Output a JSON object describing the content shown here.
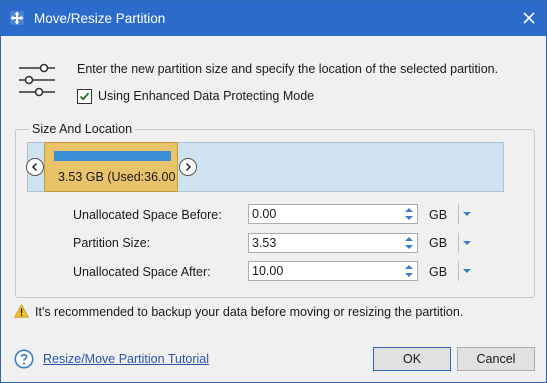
{
  "window": {
    "title": "Move/Resize Partition",
    "icon": "move-resize-app-icon"
  },
  "intro": {
    "description": "Enter the new partition size and specify the location of the selected partition.",
    "protect_mode_label": "Using Enhanced Data Protecting Mode",
    "protect_mode_checked": true,
    "icon": "sliders-icon"
  },
  "size_location": {
    "group_label": "Size And Location",
    "partition_label": "3.53 GB (Used:36.00",
    "partition_color": "#e8c36a",
    "track_color": "#cfe2ef",
    "used_bar_color": "#3a8fd4"
  },
  "fields": [
    {
      "label": "Unallocated Space Before:",
      "value": "0.00",
      "unit": "GB"
    },
    {
      "label": "Partition Size:",
      "value": "3.53",
      "unit": "GB"
    },
    {
      "label": "Unallocated Space After:",
      "value": "10.00",
      "unit": "GB"
    }
  ],
  "warning": {
    "icon": "warning-icon",
    "text": "It's recommended to backup your data before moving or resizing the partition."
  },
  "footer": {
    "help_icon": "help-icon",
    "tutorial_link": "Resize/Move Partition Tutorial",
    "ok_label": "OK",
    "cancel_label": "Cancel"
  },
  "colors": {
    "titlebar": "#2b6ccb",
    "link": "#2a56a8",
    "accent": "#2f67b5"
  }
}
